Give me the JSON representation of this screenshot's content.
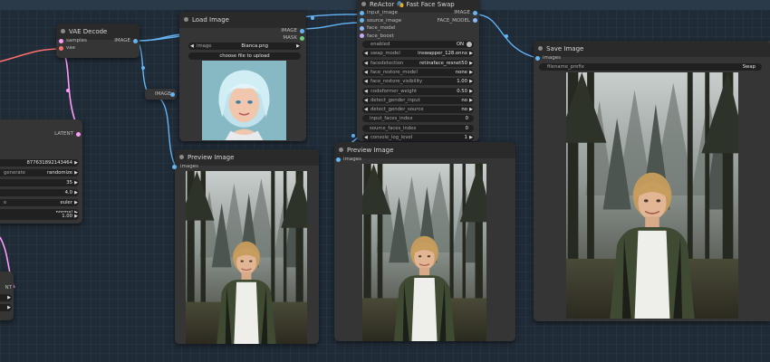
{
  "colors": {
    "link_image": "#64b5f6",
    "link_latent": "#ff9cf9",
    "link_vae": "#ff6e6e",
    "link_face_model": "#8ab8ff",
    "node_bg": "#353535",
    "canvas_bg": "#1f2b37"
  },
  "ksampler": {
    "latent_label": "LATENT",
    "seed_value": "877631892143464",
    "control_label": "generate",
    "control_value": "randomize",
    "steps_value": "35",
    "cfg_value": "4.0",
    "sampler_label": "e",
    "sampler_value": "euler",
    "scheduler_value": "normal",
    "denoise_value": "1.00"
  },
  "vae_decode": {
    "title": "VAE Decode",
    "input_samples": "samples",
    "input_vae": "vae",
    "output_image": "IMAGE"
  },
  "reroute": {
    "label": "IMAGE"
  },
  "bottom_left_node": {
    "partial_label": "NT"
  },
  "load_image": {
    "title": "Load Image",
    "output_image": "IMAGE",
    "output_mask": "MASK",
    "image_label": "image",
    "image_value": "Bianca.png",
    "upload_button": "choose file to upload",
    "preview_icon": "portrait-blue-hair-icon"
  },
  "reactor": {
    "title": "ReActor 🎭 Fast Face Swap",
    "inputs": [
      "input_image",
      "source_image",
      "face_model",
      "face_boost"
    ],
    "outputs": [
      "IMAGE",
      "FACE_MODEL"
    ],
    "widgets": [
      {
        "label": "enabled",
        "value": "ON",
        "kind": "toggle"
      },
      {
        "label": "swap_model",
        "value": "inswapper_128.onnx",
        "kind": "combo"
      },
      {
        "label": "facedetection",
        "value": "retinaface_resnet50",
        "kind": "combo"
      },
      {
        "label": "face_restore_model",
        "value": "none",
        "kind": "combo"
      },
      {
        "label": "face_restore_visibility",
        "value": "1.00",
        "kind": "number"
      },
      {
        "label": "codeformer_weight",
        "value": "0.50",
        "kind": "number"
      },
      {
        "label": "detect_gender_input",
        "value": "no",
        "kind": "combo"
      },
      {
        "label": "detect_gender_source",
        "value": "no",
        "kind": "combo"
      },
      {
        "label": "input_faces_index",
        "value": "0",
        "kind": "text"
      },
      {
        "label": "source_faces_index",
        "value": "0",
        "kind": "text"
      },
      {
        "label": "console_log_level",
        "value": "1",
        "kind": "number"
      }
    ]
  },
  "preview1": {
    "title": "Preview Image",
    "input_images": "images",
    "preview_icon": "forest-woman-image"
  },
  "preview2": {
    "title": "Preview Image",
    "input_images": "images",
    "preview_icon": "forest-woman-image"
  },
  "save_image": {
    "title": "Save Image",
    "input_images": "images",
    "prefix_label": "filename_prefix",
    "prefix_value": "Swap",
    "preview_icon": "forest-woman-image"
  }
}
